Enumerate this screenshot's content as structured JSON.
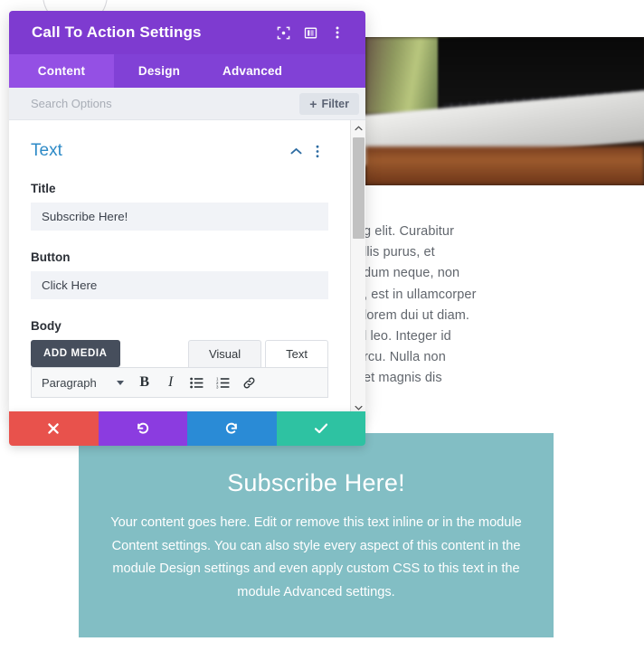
{
  "modal": {
    "title": "Call To Action Settings",
    "header_icons": [
      {
        "name": "focus-target-icon",
        "glyph": "focus"
      },
      {
        "name": "layout-panel-icon",
        "glyph": "layout"
      },
      {
        "name": "kebab-menu-icon",
        "glyph": "kebab"
      }
    ],
    "tabs": [
      {
        "label": "Content",
        "active": true
      },
      {
        "label": "Design",
        "active": false
      },
      {
        "label": "Advanced",
        "active": false
      }
    ],
    "search": {
      "placeholder": "Search Options",
      "value": "",
      "filter_label": "Filter",
      "filter_plus": "+"
    },
    "section": {
      "title": "Text",
      "collapse_icon": "chevron-up-icon",
      "menu_icon": "kebab-menu-icon"
    },
    "fields": [
      {
        "label": "Title",
        "value": "Subscribe Here!"
      },
      {
        "label": "Button",
        "value": "Click Here"
      }
    ],
    "body_field": {
      "label": "Body",
      "add_media_label": "ADD MEDIA",
      "editor_tabs": [
        {
          "label": "Visual",
          "selected": false
        },
        {
          "label": "Text",
          "selected": true
        }
      ],
      "toolbar": {
        "format_select": "Paragraph",
        "buttons": [
          {
            "name": "bold-button",
            "glyph": "B"
          },
          {
            "name": "italic-button",
            "glyph": "I"
          },
          {
            "name": "bulleted-list-button",
            "glyph": "ul"
          },
          {
            "name": "numbered-list-button",
            "glyph": "ol"
          },
          {
            "name": "insert-link-button",
            "glyph": "link"
          }
        ]
      }
    },
    "scrollbar": {
      "up_icon": "chevron-up-icon",
      "down_icon": "chevron-down-icon"
    },
    "actions": [
      {
        "name": "cancel-button",
        "icon": "close-icon",
        "color": "#e8524c"
      },
      {
        "name": "undo-button",
        "icon": "undo-icon",
        "color": "#8b3ce0"
      },
      {
        "name": "redo-button",
        "icon": "redo-icon",
        "color": "#2a8bd6"
      },
      {
        "name": "save-button",
        "icon": "checkmark-icon",
        "color": "#2ec2a2"
      }
    ]
  },
  "page": {
    "background_text": [
      "g elit. Curabitur",
      "llis purus, et",
      "dum neque, non",
      ", est in ullamcorper",
      " lorem dui ut diam.",
      "l leo. Integer id",
      "rcu. Nulla non",
      "et magnis dis"
    ],
    "cta": {
      "title": "Subscribe Here!",
      "body": "Your content goes here. Edit or remove this text inline or in the module Content settings. You can also style every aspect of this content in the module Design settings and even apply custom CSS to this text in the module Advanced settings.",
      "background_color": "#82bec4"
    }
  },
  "colors": {
    "modal_header": "#7e3bd0",
    "tab_bar": "#8141d6",
    "tab_active": "#9450e4",
    "section_title": "#2d8ac7",
    "add_media": "#464e5c"
  }
}
